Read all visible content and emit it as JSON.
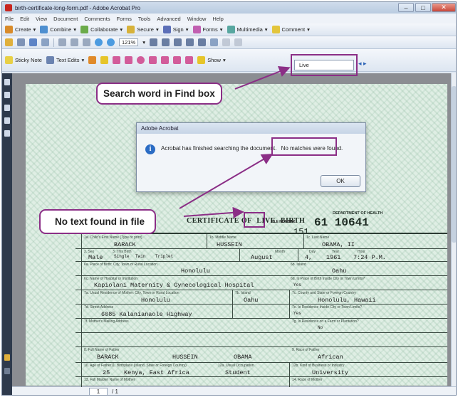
{
  "window": {
    "title": "birth-certificate-long-form.pdf - Adobe Acrobat Pro",
    "controls": {
      "minimize": "–",
      "maximize": "□",
      "close": "✕"
    }
  },
  "menu": [
    "File",
    "Edit",
    "View",
    "Document",
    "Comments",
    "Forms",
    "Tools",
    "Advanced",
    "Window",
    "Help"
  ],
  "toolbar1": {
    "create": "Create",
    "combine": "Combine",
    "collaborate": "Collaborate",
    "secure": "Secure",
    "sign": "Sign",
    "forms": "Forms",
    "multimedia": "Multimedia",
    "comment": "Comment"
  },
  "toolbar2": {
    "zoom": "121%"
  },
  "toolbar3": {
    "sticky_note": "Sticky Note",
    "text_edits": "Text Edits",
    "show": "Show"
  },
  "find": {
    "value": "Live"
  },
  "callouts": {
    "search": "Search word in Find box",
    "notfound": "No text found in file"
  },
  "dialog": {
    "title": "Adobe Acrobat",
    "message_part1": "Acrobat has finished searching the document.",
    "message_part2": "No matches were found.",
    "ok": "OK"
  },
  "status": {
    "page": "1",
    "of": "/ 1"
  },
  "certificate": {
    "title_left": "CERTIFICATE OF",
    "title_live": "LIVE",
    "title_right": "BIRTH",
    "dept_line1": "DEPARTMENT OF HEALTH",
    "file_label": "FILE NUMBER",
    "file_num": "151",
    "cert_num": "61 10641",
    "labels": {
      "child_first": "1a. Child's First Name (Type or print)",
      "child_middle": "1b. Middle Name",
      "child_last": "1c. Last Name",
      "sex": "2. Sex",
      "birth_type": "3. This Birth",
      "month": "Month",
      "day": "Day",
      "year": "Year",
      "hour": "Hour",
      "place_city": "6a. Place of Birth: City, Town or Rural Location",
      "island": "6b. Island",
      "hospital": "6c. Name of Hospital or Institution",
      "inside_city": "6d. Is Place of Birth Inside City or Town Limits?",
      "mother_res": "7a. Usual Residence of Mother: City, Town or Rural Location",
      "mother_island": "7b. Island",
      "county": "7c. County and State or Foreign Country",
      "street": "7d. Street Address",
      "res_inside": "7e. Is Residence Inside City or Town Limits?",
      "mailing": "7f. Mother's Mailing Address",
      "farm": "7g. Is Residence on a Farm or Plantation?",
      "father_name": "8. Full Name of Father",
      "father_race": "9. Race of Father",
      "father_age": "10. Age of Father",
      "father_birthplace": "11. Birthplace (Island, State or Foreign Country)",
      "occupation": "12a. Usual Occupation",
      "industry": "12b. Kind of Business or Industry",
      "mother_maiden": "13. Full Maiden Name of Mother",
      "mother_race": "14. Race of Mother"
    },
    "values": {
      "first": "BARACK",
      "middle": "HUSSEIN",
      "last": "OBAMA, II",
      "sex": "Male",
      "single": "Single",
      "twin": "Twin",
      "triplet": "Triplet",
      "month": "August",
      "day": "4,",
      "year": "1961",
      "hour": "7:24 P.M.",
      "city": "Honolulu",
      "island": "Oahu",
      "hospital": "Kapiolani Maternity & Gynecological Hospital",
      "yes1": "Yes",
      "mother_city": "Honolulu",
      "mother_island": "Oahu",
      "county": "Honolulu, Hawaii",
      "street": "6085 Kalanianaole Highway",
      "yes2": "Yes",
      "no": "No",
      "father_first": "BARACK",
      "father_middle": "HUSSEIN",
      "father_last": "OBAMA",
      "father_race": "African",
      "father_age": "25",
      "father_birthplace": "Kenya, East Africa",
      "occupation": "Student",
      "industry": "University"
    }
  }
}
